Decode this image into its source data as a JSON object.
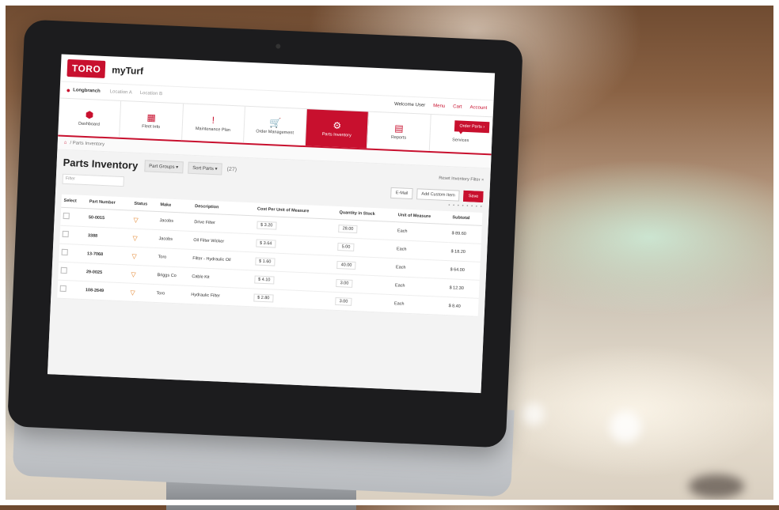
{
  "app": {
    "logo": "TORO",
    "name": "myTurf"
  },
  "location": {
    "name": "Longbranch",
    "sub1": "Location A",
    "sub2": "Location B",
    "right_items": [
      "Welcome User",
      "Menu",
      "Cart",
      "Account"
    ]
  },
  "nav": {
    "tiles": [
      {
        "label": "Dashboard",
        "icon": "dashboard-icon",
        "glyph": "⬢"
      },
      {
        "label": "Fleet Info",
        "icon": "fleet-icon",
        "glyph": "▦"
      },
      {
        "label": "Maintenance Plan",
        "icon": "wrench-icon",
        "glyph": "!"
      },
      {
        "label": "Order Management",
        "icon": "cart-icon",
        "glyph": "🛒"
      },
      {
        "label": "Parts Inventory",
        "icon": "parts-icon",
        "glyph": "⚙"
      },
      {
        "label": "Reports",
        "icon": "reports-icon",
        "glyph": "▤"
      },
      {
        "label": "Services",
        "icon": "services-icon",
        "glyph": "♦"
      }
    ],
    "active_index": 4,
    "order_button": "Order Parts ›"
  },
  "breadcrumb": {
    "home_icon": "home-icon",
    "separator": "/",
    "current": "Parts Inventory"
  },
  "parts": {
    "title": "Parts Inventory",
    "group_dropdown": "Part Groups",
    "sort_dropdown": "Sort Parts",
    "count": "(27)",
    "reset_link": "Reset Inventory Filter ×",
    "filter_placeholder": "Filter",
    "email_button": "E-Mail",
    "add_button_dropdown": "Add Custom Item",
    "add_button": "Save",
    "pager": "• • • • • • • •"
  },
  "table": {
    "columns": [
      "Select",
      "Part Number",
      "Status",
      "Make",
      "Description",
      "Cost Per Unit of Measure",
      "Quantity in Stock",
      "Unit of Measure",
      "Subtotal"
    ],
    "rows": [
      {
        "part": "50-0015",
        "make": "Jacobs",
        "description": "Drive Filter",
        "cost_sym": "$",
        "cost": "3.20",
        "qty": "28.00",
        "uom": "Each",
        "subtotal": "$ 89.60"
      },
      {
        "part": "3388",
        "make": "Jacobs",
        "description": "Oil Filter Wicker",
        "cost_sym": "$",
        "cost": "3.64",
        "qty": "5.00",
        "uom": "Each",
        "subtotal": "$ 18.20"
      },
      {
        "part": "13-7068",
        "make": "Toro",
        "description": "Filter - Hydraulic Oil",
        "cost_sym": "$",
        "cost": "1.60",
        "qty": "40.00",
        "uom": "Each",
        "subtotal": "$ 64.00"
      },
      {
        "part": "29-0025",
        "make": "Briggs Co",
        "description": "Cable Kit",
        "cost_sym": "$",
        "cost": "4.10",
        "qty": "3.00",
        "uom": "Each",
        "subtotal": "$ 12.30"
      },
      {
        "part": "108-2649",
        "make": "Toro",
        "description": "Hydraulic Filter",
        "cost_sym": "$",
        "cost": "2.80",
        "qty": "3.00",
        "uom": "Each",
        "subtotal": "$ 8.40"
      }
    ]
  },
  "colors": {
    "brand": "#c8102e",
    "status_warning": "#e07a1a"
  }
}
